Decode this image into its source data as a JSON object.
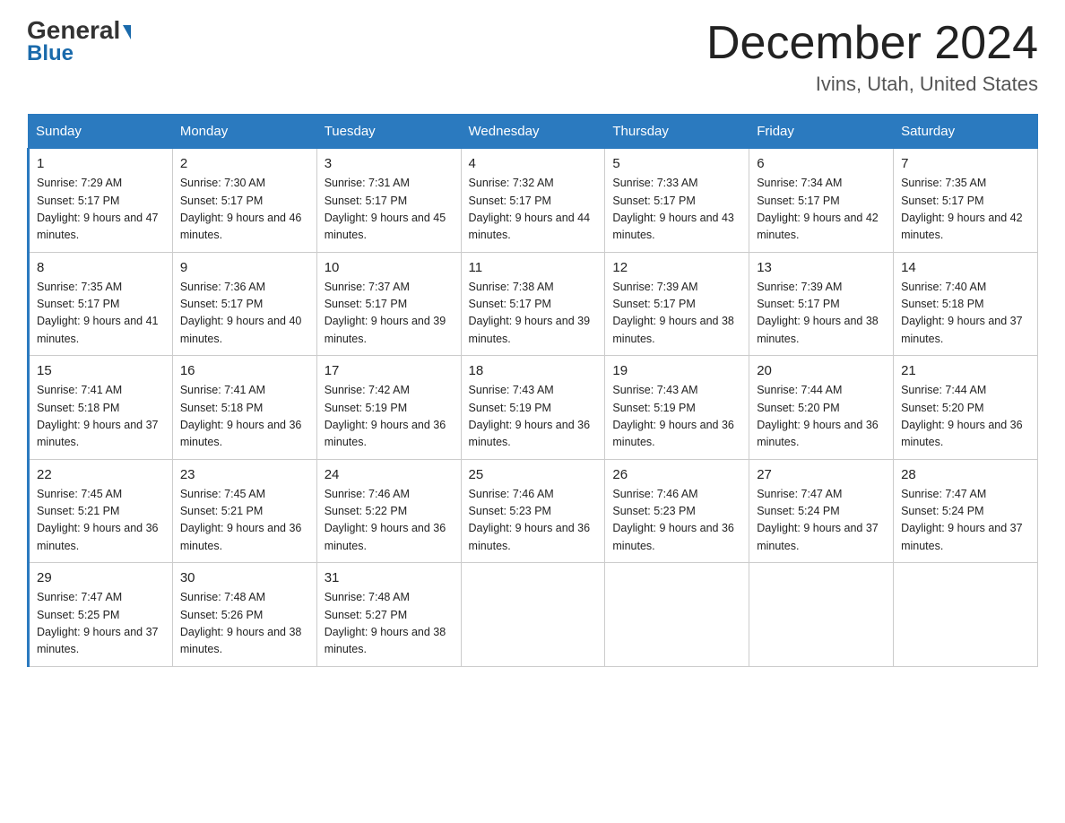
{
  "logo": {
    "general": "General",
    "blue": "Blue"
  },
  "title": "December 2024",
  "subtitle": "Ivins, Utah, United States",
  "days_of_week": [
    "Sunday",
    "Monday",
    "Tuesday",
    "Wednesday",
    "Thursday",
    "Friday",
    "Saturday"
  ],
  "weeks": [
    [
      {
        "day": "1",
        "sunrise": "7:29 AM",
        "sunset": "5:17 PM",
        "daylight": "9 hours and 47 minutes."
      },
      {
        "day": "2",
        "sunrise": "7:30 AM",
        "sunset": "5:17 PM",
        "daylight": "9 hours and 46 minutes."
      },
      {
        "day": "3",
        "sunrise": "7:31 AM",
        "sunset": "5:17 PM",
        "daylight": "9 hours and 45 minutes."
      },
      {
        "day": "4",
        "sunrise": "7:32 AM",
        "sunset": "5:17 PM",
        "daylight": "9 hours and 44 minutes."
      },
      {
        "day": "5",
        "sunrise": "7:33 AM",
        "sunset": "5:17 PM",
        "daylight": "9 hours and 43 minutes."
      },
      {
        "day": "6",
        "sunrise": "7:34 AM",
        "sunset": "5:17 PM",
        "daylight": "9 hours and 42 minutes."
      },
      {
        "day": "7",
        "sunrise": "7:35 AM",
        "sunset": "5:17 PM",
        "daylight": "9 hours and 42 minutes."
      }
    ],
    [
      {
        "day": "8",
        "sunrise": "7:35 AM",
        "sunset": "5:17 PM",
        "daylight": "9 hours and 41 minutes."
      },
      {
        "day": "9",
        "sunrise": "7:36 AM",
        "sunset": "5:17 PM",
        "daylight": "9 hours and 40 minutes."
      },
      {
        "day": "10",
        "sunrise": "7:37 AM",
        "sunset": "5:17 PM",
        "daylight": "9 hours and 39 minutes."
      },
      {
        "day": "11",
        "sunrise": "7:38 AM",
        "sunset": "5:17 PM",
        "daylight": "9 hours and 39 minutes."
      },
      {
        "day": "12",
        "sunrise": "7:39 AM",
        "sunset": "5:17 PM",
        "daylight": "9 hours and 38 minutes."
      },
      {
        "day": "13",
        "sunrise": "7:39 AM",
        "sunset": "5:17 PM",
        "daylight": "9 hours and 38 minutes."
      },
      {
        "day": "14",
        "sunrise": "7:40 AM",
        "sunset": "5:18 PM",
        "daylight": "9 hours and 37 minutes."
      }
    ],
    [
      {
        "day": "15",
        "sunrise": "7:41 AM",
        "sunset": "5:18 PM",
        "daylight": "9 hours and 37 minutes."
      },
      {
        "day": "16",
        "sunrise": "7:41 AM",
        "sunset": "5:18 PM",
        "daylight": "9 hours and 36 minutes."
      },
      {
        "day": "17",
        "sunrise": "7:42 AM",
        "sunset": "5:19 PM",
        "daylight": "9 hours and 36 minutes."
      },
      {
        "day": "18",
        "sunrise": "7:43 AM",
        "sunset": "5:19 PM",
        "daylight": "9 hours and 36 minutes."
      },
      {
        "day": "19",
        "sunrise": "7:43 AM",
        "sunset": "5:19 PM",
        "daylight": "9 hours and 36 minutes."
      },
      {
        "day": "20",
        "sunrise": "7:44 AM",
        "sunset": "5:20 PM",
        "daylight": "9 hours and 36 minutes."
      },
      {
        "day": "21",
        "sunrise": "7:44 AM",
        "sunset": "5:20 PM",
        "daylight": "9 hours and 36 minutes."
      }
    ],
    [
      {
        "day": "22",
        "sunrise": "7:45 AM",
        "sunset": "5:21 PM",
        "daylight": "9 hours and 36 minutes."
      },
      {
        "day": "23",
        "sunrise": "7:45 AM",
        "sunset": "5:21 PM",
        "daylight": "9 hours and 36 minutes."
      },
      {
        "day": "24",
        "sunrise": "7:46 AM",
        "sunset": "5:22 PM",
        "daylight": "9 hours and 36 minutes."
      },
      {
        "day": "25",
        "sunrise": "7:46 AM",
        "sunset": "5:23 PM",
        "daylight": "9 hours and 36 minutes."
      },
      {
        "day": "26",
        "sunrise": "7:46 AM",
        "sunset": "5:23 PM",
        "daylight": "9 hours and 36 minutes."
      },
      {
        "day": "27",
        "sunrise": "7:47 AM",
        "sunset": "5:24 PM",
        "daylight": "9 hours and 37 minutes."
      },
      {
        "day": "28",
        "sunrise": "7:47 AM",
        "sunset": "5:24 PM",
        "daylight": "9 hours and 37 minutes."
      }
    ],
    [
      {
        "day": "29",
        "sunrise": "7:47 AM",
        "sunset": "5:25 PM",
        "daylight": "9 hours and 37 minutes."
      },
      {
        "day": "30",
        "sunrise": "7:48 AM",
        "sunset": "5:26 PM",
        "daylight": "9 hours and 38 minutes."
      },
      {
        "day": "31",
        "sunrise": "7:48 AM",
        "sunset": "5:27 PM",
        "daylight": "9 hours and 38 minutes."
      },
      null,
      null,
      null,
      null
    ]
  ]
}
